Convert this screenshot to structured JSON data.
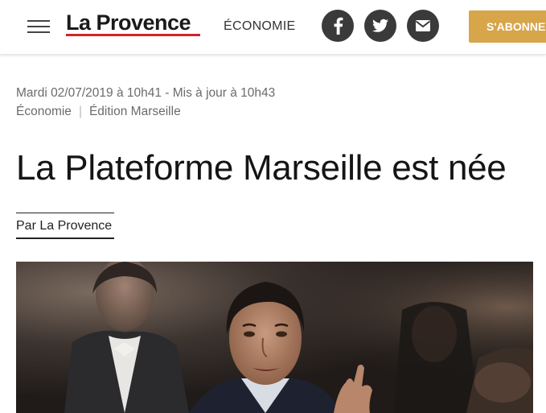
{
  "header": {
    "logo": "La Provence",
    "section": "ÉCONOMIE",
    "subscribe_label": "S'ABONNER",
    "social": [
      {
        "name": "facebook",
        "icon": "facebook-icon"
      },
      {
        "name": "twitter",
        "icon": "twitter-icon"
      },
      {
        "name": "email",
        "icon": "mail-icon"
      }
    ],
    "colors": {
      "logo_underline": "#d3222a",
      "subscribe_bg": "#d7a54a",
      "social_bg": "#3a3a3a"
    }
  },
  "article": {
    "date": "Mardi 02/07/2019 à 10h41 - Mis à jour à 10h43",
    "categories": [
      "Économie",
      "Édition Marseille"
    ],
    "category_separator": "|",
    "title": "La Plateforme Marseille est née",
    "author": "Par La Provence"
  }
}
